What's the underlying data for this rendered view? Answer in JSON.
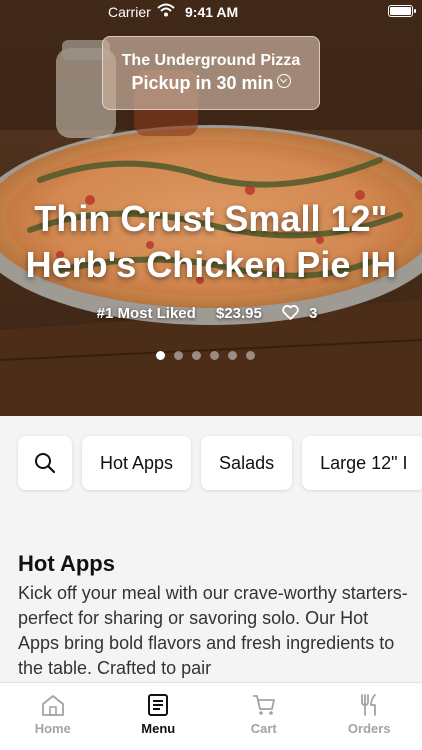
{
  "status_bar": {
    "carrier": "Carrier",
    "time": "9:41 AM"
  },
  "store": {
    "name": "The Underground Pizza",
    "pickup": "Pickup in 30 min"
  },
  "featured": {
    "title_line1": "Thin Crust Small 12\"",
    "title_line2": "Herb's Chicken Pie IH",
    "badge": "#1 Most Liked",
    "price": "$23.95",
    "likes": "3",
    "carousel_count": 6,
    "carousel_active": 1
  },
  "categories": {
    "items": [
      "Hot Apps",
      "Salads",
      "Large 12\" I"
    ]
  },
  "section": {
    "title": "Hot Apps",
    "description": "Kick off your meal with our crave-worthy starters-perfect for sharing or savoring solo. Our Hot Apps bring bold flavors and fresh ingredients to the table.  Crafted to pair"
  },
  "tabs": [
    {
      "label": "Home",
      "icon": "home-icon"
    },
    {
      "label": "Menu",
      "icon": "menu-book-icon"
    },
    {
      "label": "Cart",
      "icon": "cart-icon"
    },
    {
      "label": "Orders",
      "icon": "fork-knife-icon"
    }
  ],
  "colors": {
    "active_tab": "#111111",
    "inactive_tab": "#a3a3a3",
    "background": "#f4f4f5"
  }
}
